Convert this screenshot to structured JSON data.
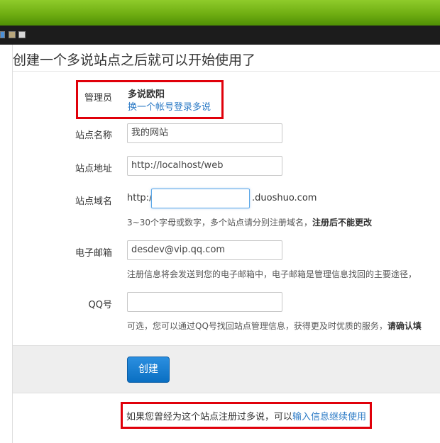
{
  "page": {
    "heading": "创建一个多说站点之后就可以开始使用了"
  },
  "admin": {
    "label": "管理员",
    "name": "多说欧阳",
    "switch_link": "换一个帐号登录多说"
  },
  "site_name": {
    "label": "站点名称",
    "value": "我的网站"
  },
  "site_url": {
    "label": "站点地址",
    "value": "http://localhost/web"
  },
  "site_domain": {
    "label": "站点域名",
    "prefix": "http://",
    "value": "",
    "suffix": ".duoshuo.com",
    "hint": "3~30个字母或数字，多个站点请分别注册域名，",
    "hint_strong": "注册后不能更改"
  },
  "email": {
    "label": "电子邮箱",
    "value": "desdev@vip.qq.com",
    "hint": "注册信息将会发送到您的电子邮箱中，电子邮箱是管理信息找回的主要途径，"
  },
  "qq": {
    "label": "QQ号",
    "value": "",
    "hint": "可选，您可以通过QQ号找回站点管理信息，获得更及时优质的服务，",
    "hint_strong": "请确认填"
  },
  "actions": {
    "create_label": "创建"
  },
  "footer": {
    "note": "如果您曾经为这个站点注册过多说，可以",
    "link": "输入信息继续使用"
  },
  "colors": {
    "topbar": "#6fae12",
    "highlight_box": "#e0000a",
    "link": "#2a79c5",
    "primary_button": "#1a7fd4"
  }
}
